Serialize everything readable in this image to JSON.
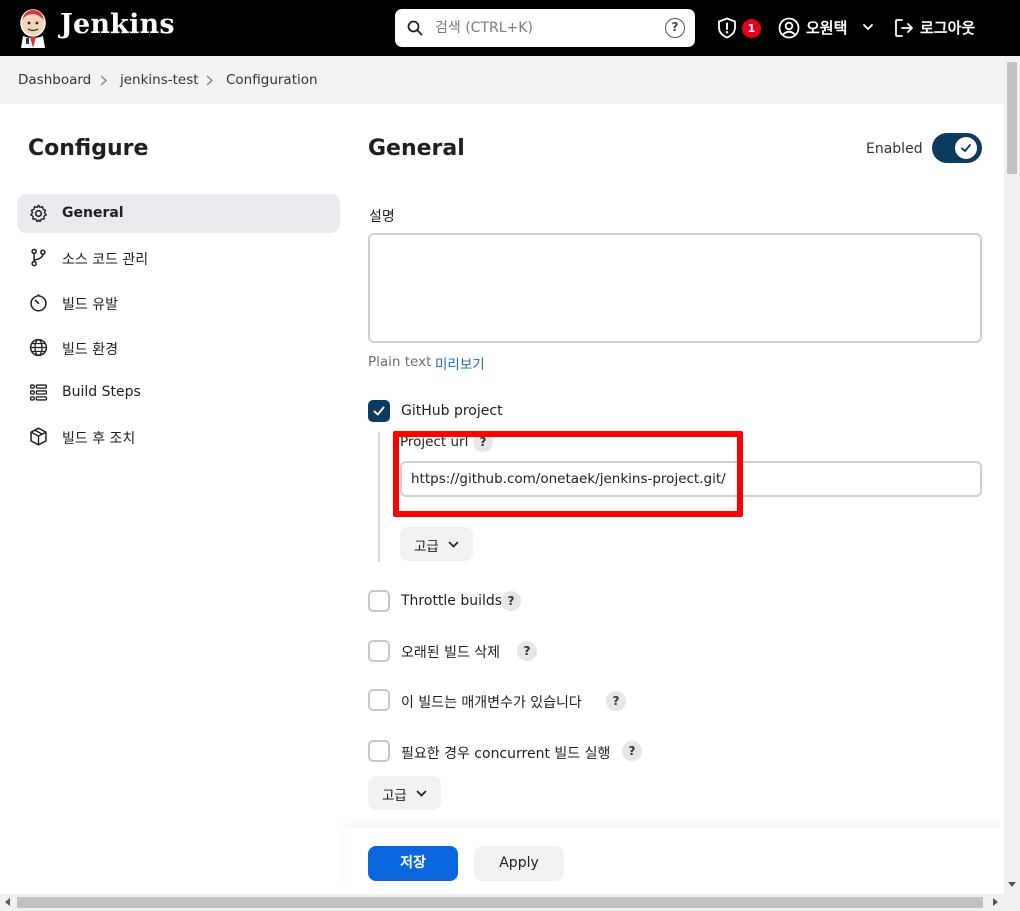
{
  "header": {
    "logo_text": "Jenkins",
    "search_placeholder": "검색 (CTRL+K)",
    "search_help": "?",
    "security_badge": "1",
    "user_name": "오원택",
    "logout_label": "로그아웃"
  },
  "breadcrumb": [
    "Dashboard",
    "jenkins-test",
    "Configuration"
  ],
  "sidebar": {
    "title": "Configure",
    "items": [
      {
        "label": "General",
        "icon": "gear-icon",
        "active": true
      },
      {
        "label": "소스 코드 관리",
        "icon": "branch-icon",
        "active": false
      },
      {
        "label": "빌드 유발",
        "icon": "timer-icon",
        "active": false
      },
      {
        "label": "빌드 환경",
        "icon": "globe-icon",
        "active": false
      },
      {
        "label": "Build Steps",
        "icon": "list-icon",
        "active": false
      },
      {
        "label": "빌드 후 조치",
        "icon": "package-icon",
        "active": false
      }
    ]
  },
  "main": {
    "title": "General",
    "enabled_label": "Enabled",
    "enabled": true,
    "description_label": "설명",
    "description_value": "",
    "plain_text_label": "Plain text",
    "preview_link": "미리보기",
    "github_project": {
      "label": "GitHub project",
      "checked": true,
      "project_url_label": "Project url",
      "project_url_value": "https://github.com/onetaek/jenkins-project.git/",
      "advanced_label": "고급"
    },
    "options": [
      {
        "label": "Throttle builds",
        "checked": false
      },
      {
        "label": "오래된 빌드 삭제",
        "checked": false
      },
      {
        "label": "이 빌드는 매개변수가 있습니다",
        "checked": false
      },
      {
        "label": "필요한 경우 concurrent 빌드 실행",
        "checked": false
      }
    ],
    "help_symbol": "?",
    "advanced_label": "고급"
  },
  "footer": {
    "save_label": "저장",
    "apply_label": "Apply"
  },
  "colors": {
    "header_bg": "#000000",
    "primary_button": "#0a67dd",
    "checkbox_checked": "#0b3b5e",
    "badge": "#e6001f",
    "highlight_box": "#ff0000",
    "link": "#1769c8"
  }
}
